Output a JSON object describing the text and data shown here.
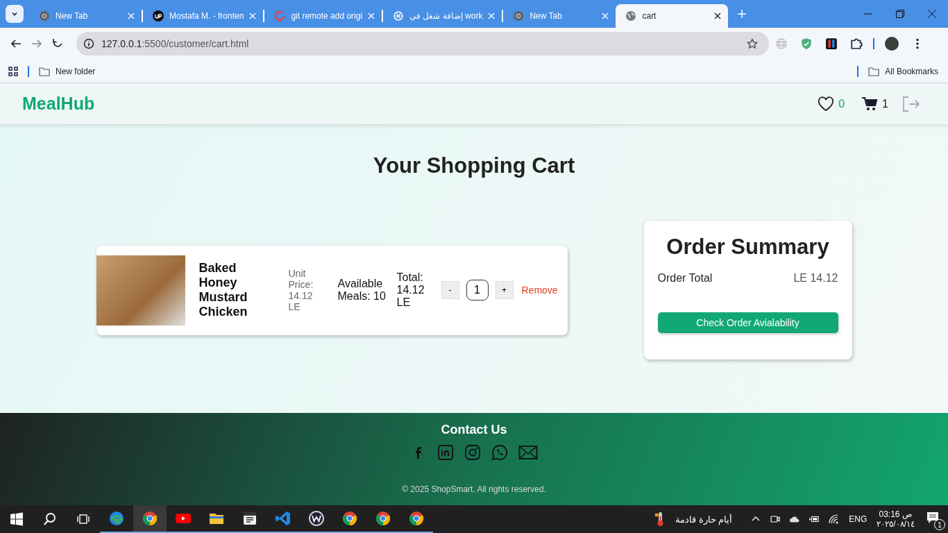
{
  "browser": {
    "tabs": [
      {
        "title": "New Tab",
        "kind": "chrome",
        "selected": false
      },
      {
        "title": "Mostafa M. - fronten",
        "kind": "upwork",
        "selected": false
      },
      {
        "title": "git remote add origi",
        "kind": "google",
        "selected": false
      },
      {
        "title": "إضافة شغل في work",
        "kind": "openai",
        "selected": false
      },
      {
        "title": "New Tab",
        "kind": "chrome",
        "selected": false
      },
      {
        "title": "cart",
        "kind": "globe",
        "selected": true
      }
    ],
    "address": {
      "host": "127.0.0.1",
      "path": ":5500/customer/cart.html"
    },
    "bookmarks": [
      {
        "label": "New folder"
      }
    ],
    "all_bookmarks": "All Bookmarks"
  },
  "navbar": {
    "brand": "MealHub",
    "wishlist_count": "0",
    "cart_count": "1"
  },
  "page_title": "Your Shopping Cart",
  "cart_items": [
    {
      "name": "Baked Honey Mustard Chicken",
      "unit_price": "Unit Price: 14.12 LE",
      "available": "Available Meals: 10",
      "total": "Total: 14.12 LE",
      "decrease": "-",
      "quantity": "1",
      "increase": "+",
      "remove": "Remove"
    }
  ],
  "order_summary": {
    "title": "Order Summary",
    "rows": [
      {
        "label": "Order Total",
        "value": "LE 14.12"
      }
    ],
    "button": "Check Order Avialability"
  },
  "footer": {
    "heading": "Contact Us",
    "socials": [
      {
        "kind": "facebook"
      },
      {
        "kind": "linkedin"
      },
      {
        "kind": "instagram"
      },
      {
        "kind": "whatsapp"
      },
      {
        "kind": "email"
      }
    ],
    "copyright": "© 2025 ShopSmart. All rights reserved."
  },
  "taskbar": {
    "apps": [
      {
        "kind": "edge",
        "selected": false
      },
      {
        "kind": "chrome",
        "selected": true
      },
      {
        "kind": "youtube",
        "selected": false
      },
      {
        "kind": "folder",
        "selected": false
      },
      {
        "kind": "calendar",
        "selected": false
      },
      {
        "kind": "vscode",
        "selected": false
      },
      {
        "kind": "wps",
        "selected": false
      },
      {
        "kind": "chrome",
        "selected": false
      },
      {
        "kind": "chrome",
        "selected": false
      },
      {
        "kind": "chrome",
        "selected": false
      }
    ],
    "weather": "أيام حارة قادمة",
    "language": "ENG",
    "time": "03:16 ص",
    "date": "٢٠٢٥/٠٨/١٤",
    "notifications": "1"
  }
}
